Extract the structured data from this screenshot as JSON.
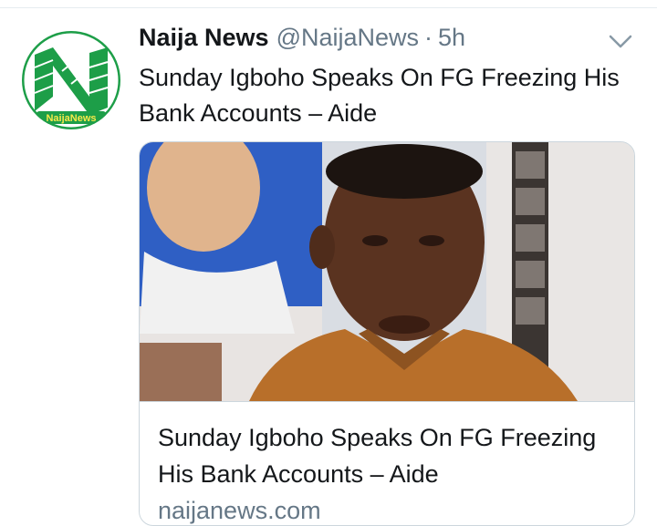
{
  "tweet": {
    "author_name": "Naija News",
    "author_handle": "@NaijaNews",
    "separator": "·",
    "time": "5h",
    "text": "Sunday Igboho Speaks On FG Freezing His Bank Accounts – Aide",
    "avatar_logo_text": "NaijaNews"
  },
  "card": {
    "title": "Sunday Igboho Speaks On FG Freezing His Bank Accounts – Aide",
    "domain": "naijanews.com"
  },
  "icons": {
    "menu": "chevron-down-icon"
  },
  "colors": {
    "brand_green": "#1d9e48",
    "secondary_text": "#657786",
    "border": "#ccd6dd"
  }
}
